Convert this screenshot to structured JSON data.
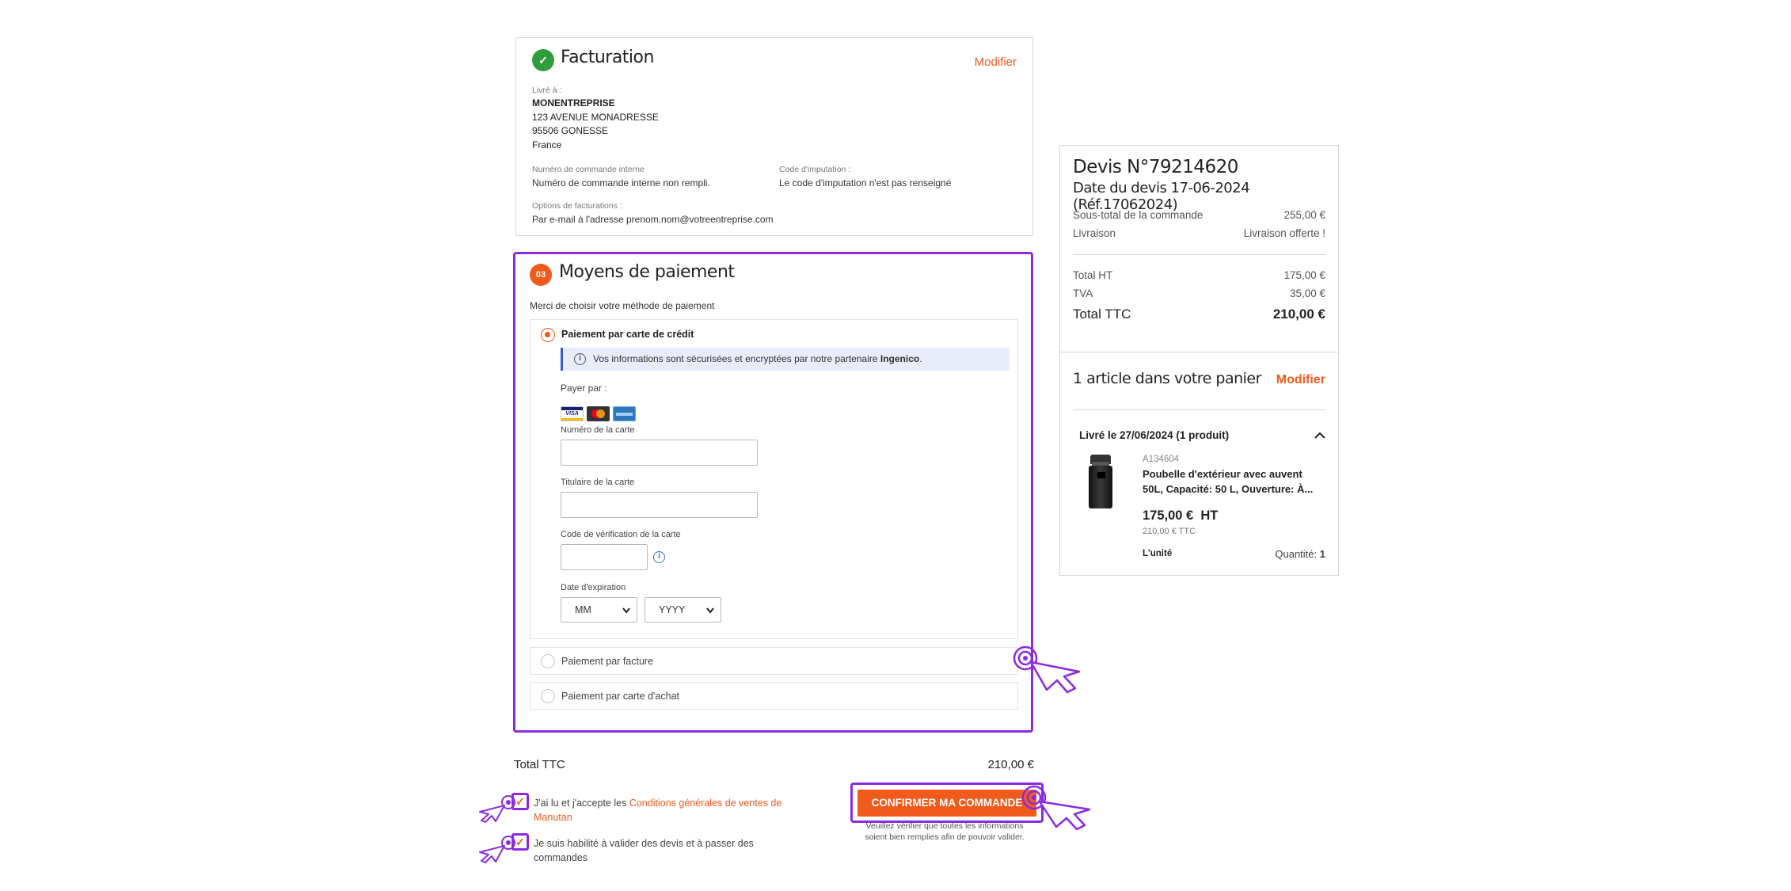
{
  "billing": {
    "title": "Facturation",
    "edit_label": "Modifier",
    "delivered_to_label": "Livré à :",
    "company": "MONENTREPRISE",
    "street": "123 AVENUE MONADRESSE",
    "city": "95506 GONESSE",
    "country": "France",
    "order_number_label": "Numéro de commande interne",
    "order_number_value": "Numéro de commande interne non rempli.",
    "imputation_label": "Code d'imputation :",
    "imputation_value": "Le code d'imputation n'est pas renseigné",
    "options_label": "Options de facturations :",
    "options_value": "Par e-mail à l'adresse prenom.nom@votreentreprise.com"
  },
  "payment": {
    "step": "03",
    "title": "Moyens de paiement",
    "subtitle": "Merci de choisir votre méthode de paiement",
    "card_option_label": "Paiement par carte de crédit",
    "secure_text": "Vos informations sont sécurisées et encryptées par notre partenaire",
    "secure_partner": "Ingenico",
    "secure_suffix": ".",
    "pay_by_label": "Payer par :",
    "card_brands": [
      "VISA",
      "MC",
      "AMEX"
    ],
    "card_number_label": "Numéro de la carte",
    "card_holder_label": "Titulaire de la carte",
    "cvv_label": "Code de vérification de la carte",
    "expiry_label": "Date d'expiration",
    "month_value": "MM",
    "year_value": "YYYY",
    "invoice_option_label": "Paiement par facture",
    "purchase_card_option_label": "Paiement par carte d'achat"
  },
  "summary": {
    "quote_title": "Devis N°79214620",
    "quote_date": "Date du devis 17-06-2024 (Réf.17062024)",
    "subtotal_label": "Sous-total de la commande",
    "subtotal_value": "255,00 €",
    "delivery_label": "Livraison",
    "delivery_value": "Livraison offerte !",
    "total_ht_label": "Total HT",
    "total_ht_value": "175,00 €",
    "tva_label": "TVA",
    "tva_value": "35,00 €",
    "total_ttc_label": "Total TTC",
    "total_ttc_value": "210,00 €",
    "cart_title": "1 article dans votre panier",
    "cart_edit_label": "Modifier",
    "delivery_group": "Livré le 27/06/2024 (1 produit)",
    "product": {
      "ref": "A134604",
      "name": "Poubelle d'extérieur avec auvent 50L, Capacité: 50 L, Ouverture: À...",
      "price_ht": "175,00 €  HT",
      "price_ttc": "210,00 € TTC",
      "unit": "L'unité",
      "quantity_label": "Quantité:",
      "quantity_value": "1"
    }
  },
  "footer": {
    "total_label": "Total TTC",
    "total_value": "210,00 €",
    "terms_prefix": "J'ai lu et j'accepte les",
    "terms_link": "Conditions générales de ventes de Manutan",
    "authorized_text": "Je suis habilité à valider des devis et à passer des commandes",
    "confirm_label": "CONFIRMER MA COMMANDE",
    "confirm_note": "Veuillez vérifier que toutes les informations soient bien remplies afin de pouvoir valider."
  },
  "colors": {
    "accent": "#f25a1b",
    "highlight": "#8a2be2",
    "success": "#2e9e3c",
    "info": "#3a5bd0"
  }
}
